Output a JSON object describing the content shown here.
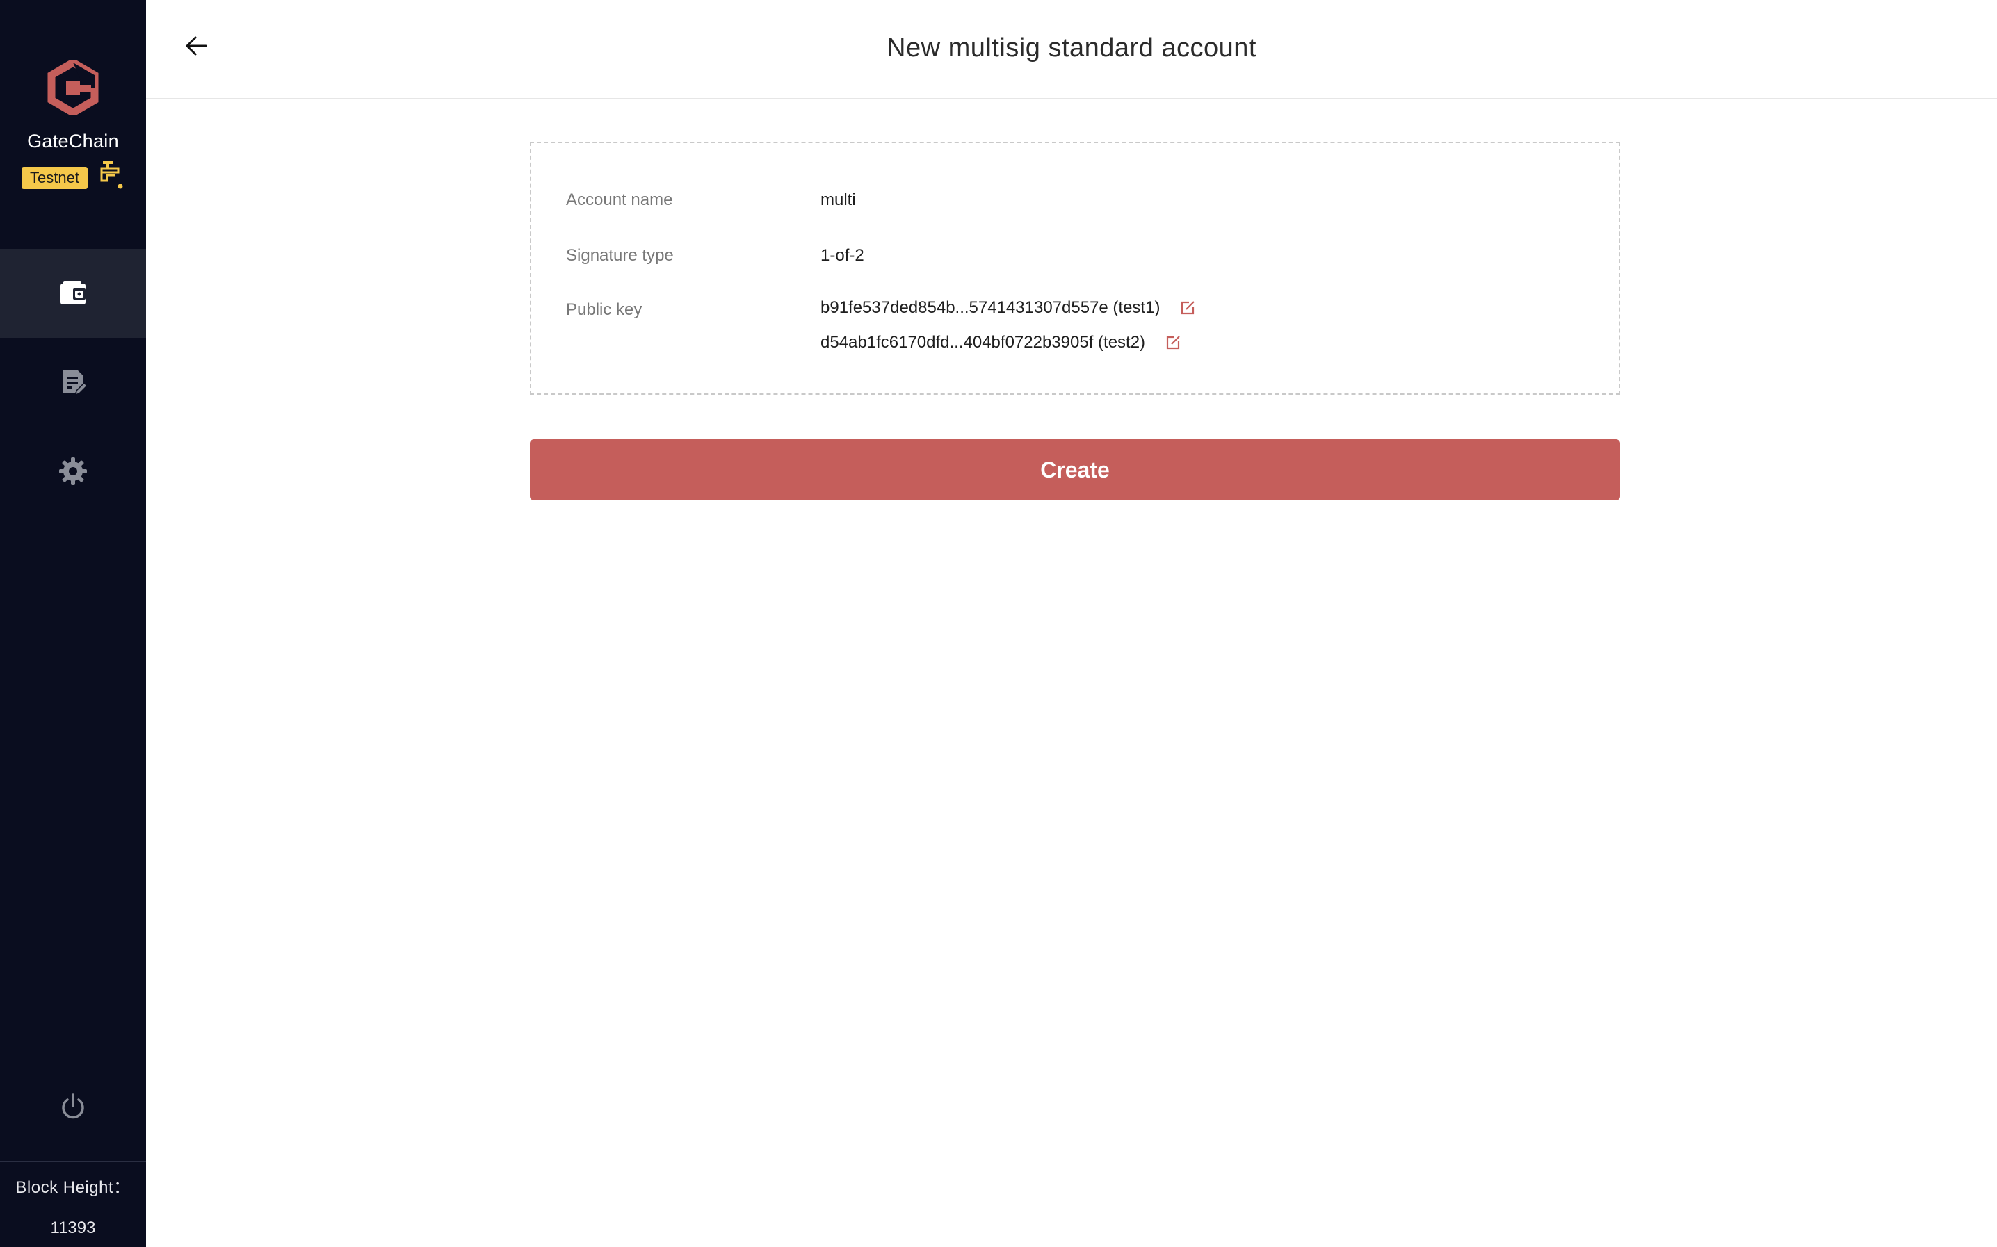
{
  "sidebar": {
    "brand_name": "GateChain",
    "network_badge": "Testnet",
    "logo_icon": "gatechain-logo-icon",
    "faucet_icon": "faucet-icon",
    "nav": [
      {
        "icon": "wallet-icon",
        "active": true
      },
      {
        "icon": "document-edit-icon",
        "active": false
      },
      {
        "icon": "gear-icon",
        "active": false
      }
    ],
    "power_icon": "power-icon",
    "block_height_label": "Block Height：",
    "block_height_value": "11393"
  },
  "header": {
    "back_icon": "arrow-left-icon",
    "title": "New multisig standard account"
  },
  "details": {
    "account_name_label": "Account name",
    "account_name_value": "multi",
    "signature_type_label": "Signature type",
    "signature_type_value": "1-of-2",
    "public_key_label": "Public key",
    "public_keys": [
      "b91fe537ded854b...5741431307d557e (test1)",
      "d54ab1fc6170dfd...404bf0722b3905f (test2)"
    ]
  },
  "actions": {
    "create_label": "Create"
  },
  "colors": {
    "sidebar_bg": "#0a0d1f",
    "sidebar_active": "#1f2332",
    "accent": "#c55e5b",
    "badge": "#f5c84a"
  }
}
